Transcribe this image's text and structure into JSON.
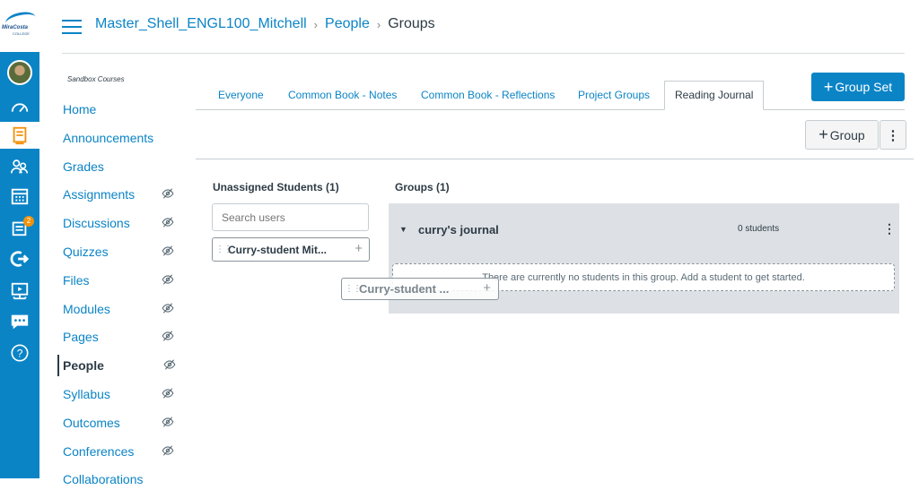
{
  "breadcrumb": {
    "course": "Master_Shell_ENGL100_Mitchell",
    "section": "People",
    "current": "Groups"
  },
  "logo": {
    "line1": "MiraCosta",
    "line2": "COLLEGE"
  },
  "global_nav": {
    "notification_count": "2"
  },
  "course_nav": {
    "subtitle": "Sandbox Courses",
    "items": [
      {
        "label": "Home",
        "hidden": false
      },
      {
        "label": "Announcements",
        "hidden": false
      },
      {
        "label": "Grades",
        "hidden": false
      },
      {
        "label": "Assignments",
        "hidden": true
      },
      {
        "label": "Discussions",
        "hidden": true
      },
      {
        "label": "Quizzes",
        "hidden": true
      },
      {
        "label": "Files",
        "hidden": true
      },
      {
        "label": "Modules",
        "hidden": true
      },
      {
        "label": "Pages",
        "hidden": true
      },
      {
        "label": "People",
        "hidden": true,
        "active": true
      },
      {
        "label": "Syllabus",
        "hidden": true
      },
      {
        "label": "Outcomes",
        "hidden": true
      },
      {
        "label": "Conferences",
        "hidden": true
      },
      {
        "label": "Collaborations",
        "hidden": false
      }
    ]
  },
  "tabs": [
    "Everyone",
    "Common Book - Notes",
    "Common Book - Reflections",
    "Project Groups",
    "Reading Journal"
  ],
  "buttons": {
    "group_set": "Group Set",
    "group": "Group"
  },
  "unassigned": {
    "heading": "Unassigned Students (1)",
    "search_placeholder": "Search users",
    "student": "Curry-student Mit..."
  },
  "groups": {
    "heading": "Groups (1)",
    "group_name": "curry's journal",
    "student_count": "0 students",
    "empty_message": "There are currently no students in this group. Add a student to get started."
  },
  "drag_item": "Curry-student ...",
  "colors": {
    "accent": "#0b84c6",
    "badge": "#f2910a"
  }
}
